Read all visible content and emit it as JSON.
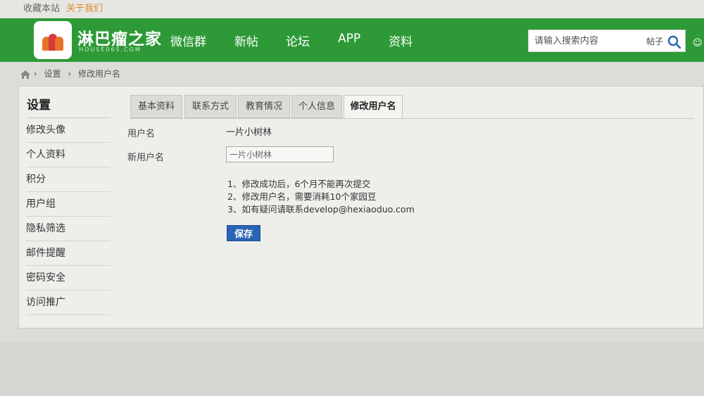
{
  "topbar": {
    "favorite": "收藏本站",
    "about": "关于我们"
  },
  "header": {
    "site_name": "淋巴瘤之家",
    "site_sub": "HOUSE06S.COM",
    "nav": [
      "微信群",
      "新帖",
      "论坛",
      "APP",
      "资料"
    ],
    "search": {
      "placeholder": "请输入搜索内容",
      "type": "帖子"
    }
  },
  "breadcrumb": [
    "设置",
    "修改用户名"
  ],
  "sidebar": {
    "title": "设置",
    "items": [
      "修改头像",
      "个人资料",
      "积分",
      "用户组",
      "隐私筛选",
      "邮件提醒",
      "密码安全",
      "访问推广"
    ]
  },
  "tabs": [
    {
      "label": "基本资料",
      "active": false
    },
    {
      "label": "联系方式",
      "active": false
    },
    {
      "label": "教育情况",
      "active": false
    },
    {
      "label": "个人信息",
      "active": false
    },
    {
      "label": "修改用户名",
      "active": true
    }
  ],
  "form": {
    "username_label": "用户名",
    "username_value": "一片小树林",
    "new_username_label": "新用户名",
    "new_username_value": "一片小树林",
    "notes": [
      "1、修改成功后，6个月不能再次提交",
      "2、修改用户名，需要消耗10个家园豆",
      "3、如有疑问请联系develop@hexiaoduo.com"
    ],
    "save_label": "保存"
  },
  "colors": {
    "header_green": "#2e9a37",
    "about_orange": "#e08a2a",
    "save_blue": "#2a64b4"
  }
}
